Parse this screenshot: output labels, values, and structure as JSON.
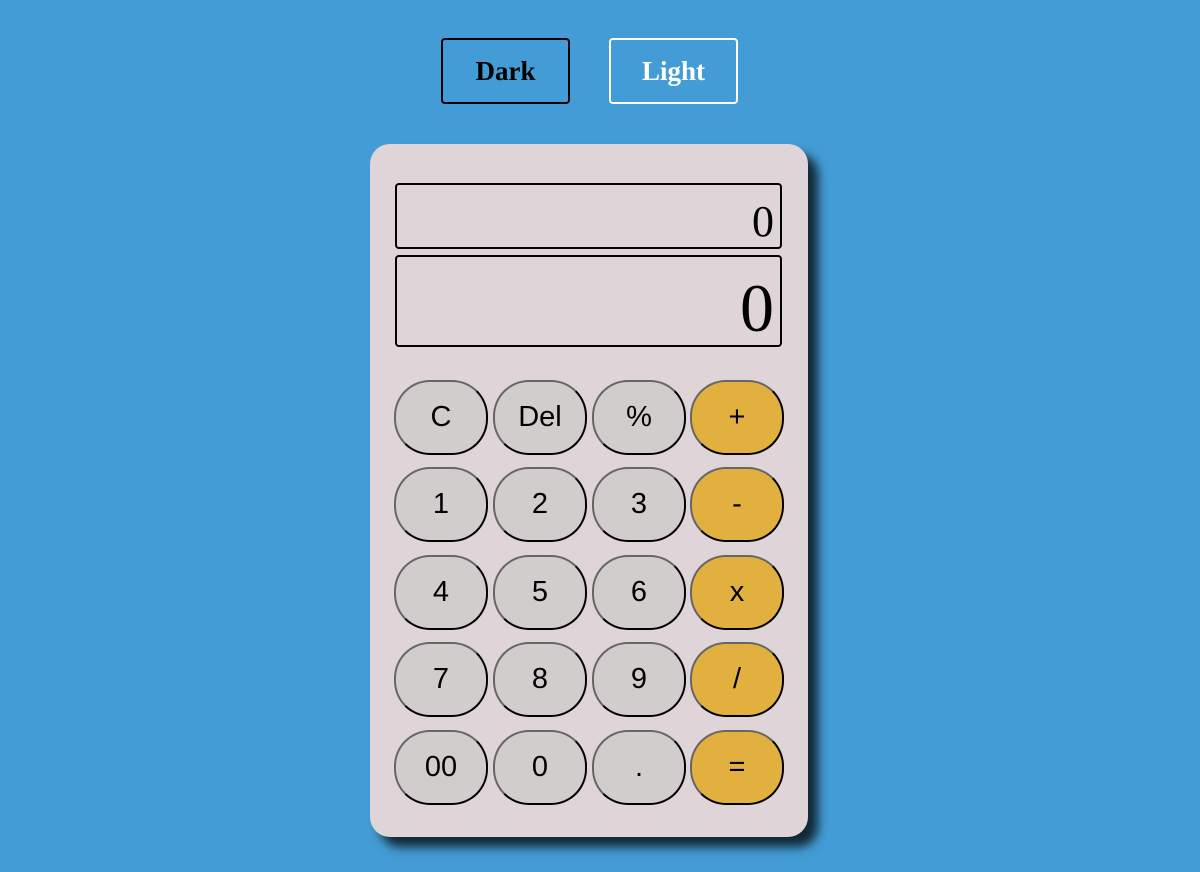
{
  "theme_buttons": {
    "dark": "Dark",
    "light": "Light"
  },
  "display": {
    "previous": "0",
    "current": "0"
  },
  "keys": [
    [
      "C",
      "Del",
      "%",
      "+"
    ],
    [
      "1",
      "2",
      "3",
      "-"
    ],
    [
      "4",
      "5",
      "6",
      "x"
    ],
    [
      "7",
      "8",
      "9",
      "/"
    ],
    [
      "00",
      "0",
      ".",
      "="
    ]
  ],
  "colors": {
    "background": "#439cd5",
    "calculator": "#dfd5d8",
    "key": "#d1cdcd",
    "operator_key": "#e2b03e"
  }
}
